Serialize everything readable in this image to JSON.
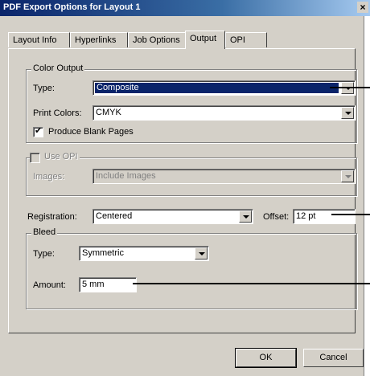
{
  "window": {
    "title": "PDF Export Options for Layout 1",
    "close_label": "×"
  },
  "tabs": [
    {
      "label": "Layout Info"
    },
    {
      "label": "Hyperlinks"
    },
    {
      "label": "Job Options"
    },
    {
      "label": "Output",
      "active": true
    },
    {
      "label": "OPI"
    }
  ],
  "color_output": {
    "legend": "Color Output",
    "type_label": "Type:",
    "type_value": "Composite",
    "print_colors_label": "Print Colors:",
    "print_colors_value": "CMYK",
    "blank_pages_label": "Produce Blank Pages",
    "blank_pages_checked": true
  },
  "opi": {
    "legend": "Use OPI",
    "checked": false,
    "images_label": "Images:",
    "images_value": "Include Images"
  },
  "registration": {
    "label": "Registration:",
    "value": "Centered",
    "offset_label": "Offset:",
    "offset_value": "12 pt"
  },
  "bleed": {
    "legend": "Bleed",
    "type_label": "Type:",
    "type_value": "Symmetric",
    "amount_label": "Amount:",
    "amount_value": "5 mm"
  },
  "buttons": {
    "ok": "OK",
    "cancel": "Cancel"
  },
  "colors": {
    "title_bar": "#0a246a",
    "dialog_bg": "#d4d0c8",
    "selection": "#0a246a"
  }
}
